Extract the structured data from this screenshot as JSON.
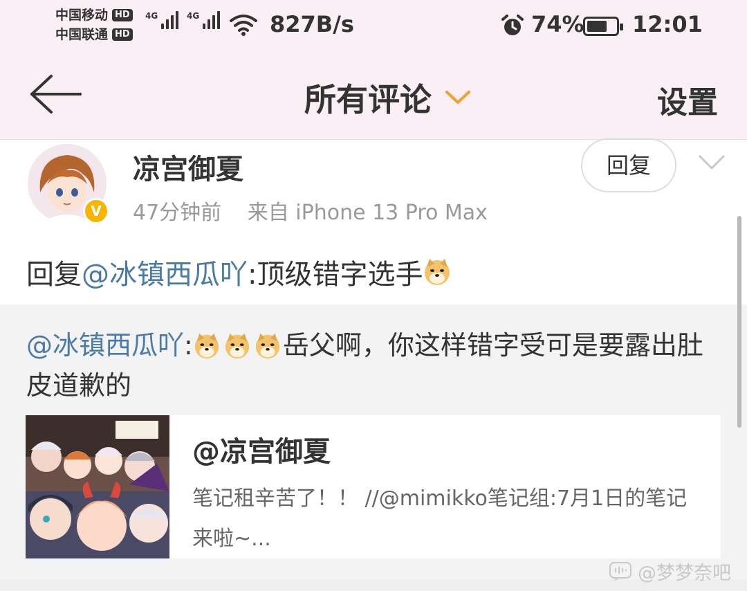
{
  "status_bar": {
    "carrier1": "中国移动",
    "carrier2": "中国联通",
    "hd_label": "HD",
    "network_tag": "4G",
    "net_speed": "827B/s",
    "battery": "74%",
    "battery_level": 0.74,
    "time": "12:01"
  },
  "header": {
    "title": "所有评论",
    "settings_label": "设置",
    "accent_color": "#f0a030"
  },
  "comment": {
    "username": "凉宫御夏",
    "verified_mark": "V",
    "time_ago": "47分钟前",
    "source": "来自 iPhone 13 Pro Max",
    "reply_button": "回复",
    "text_prefix": "回复",
    "mention": "@冰镇西瓜吖",
    "text_body": ":顶级错字选手",
    "emoji": "doge-emoji"
  },
  "quoted": {
    "mention": "@冰镇西瓜吖",
    "colon": ":",
    "text": "岳父啊，你这样错字受可是要露出肚皮道歉的",
    "emoji_count": 3,
    "card": {
      "title": "@凉宫御夏",
      "description": "笔记租辛苦了！！ //@mimikko笔记组:7月1日的笔记来啦~..."
    }
  },
  "watermark": "@梦梦奈吧",
  "colors": {
    "mention": "#4a7aa6",
    "header_bg": "#f9eff5",
    "quoted_bg": "#f3f3f3"
  }
}
